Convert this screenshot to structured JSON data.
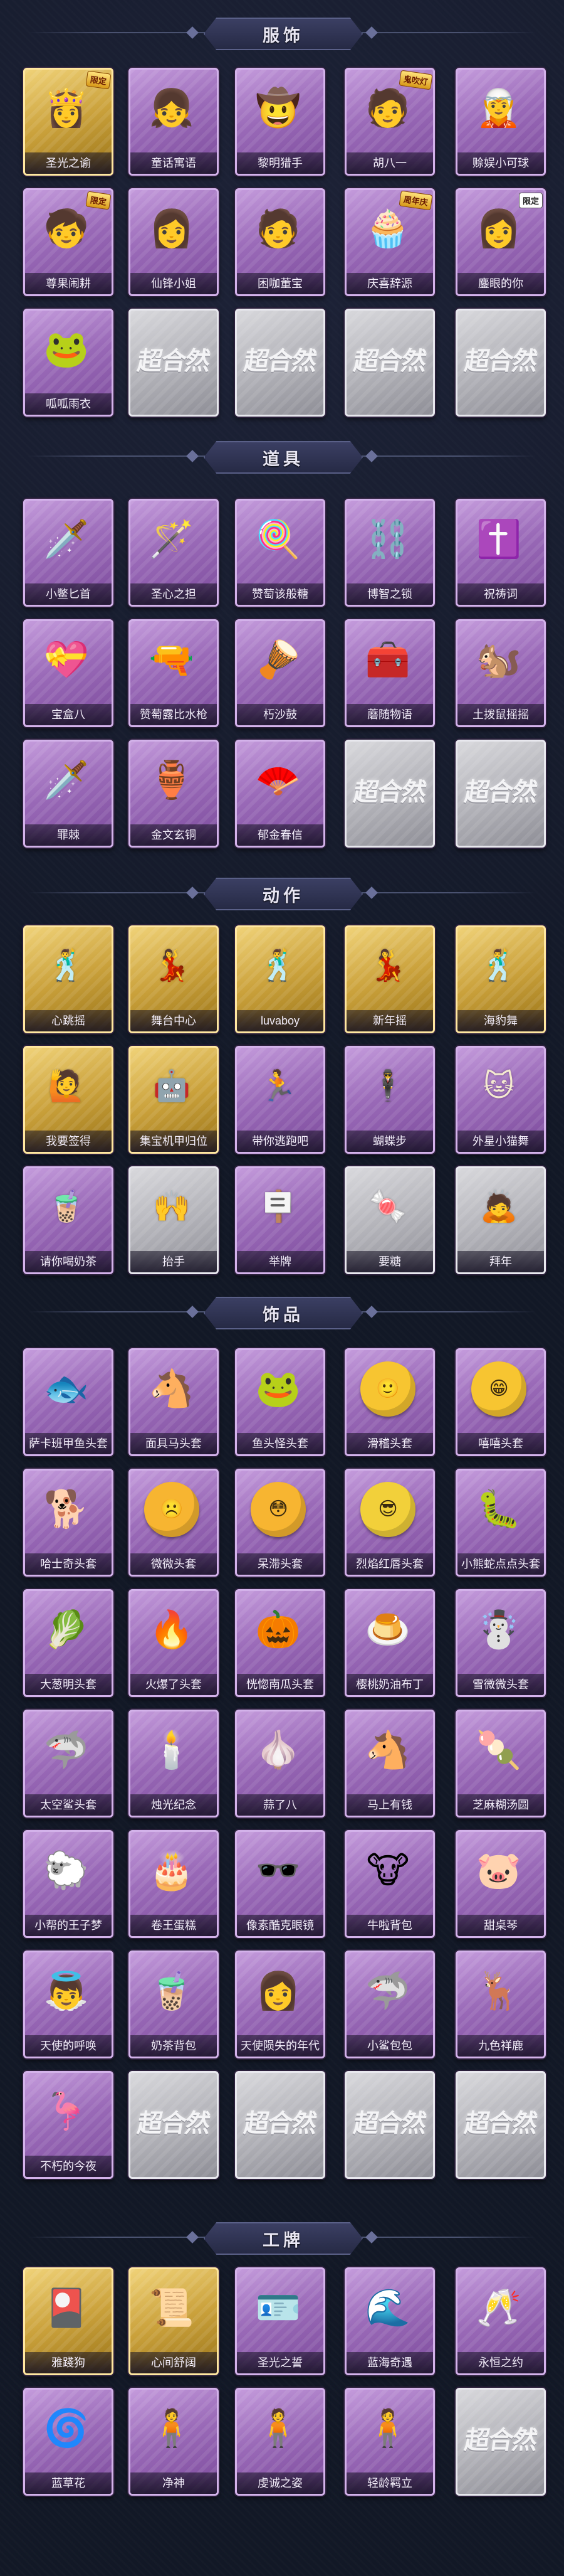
{
  "sections": [
    {
      "title": "服饰",
      "items": [
        {
          "label": "圣光之谕",
          "tier": "gold",
          "art": "👸",
          "badge": "限定"
        },
        {
          "label": "童话寓语",
          "tier": "purple",
          "art": "👧"
        },
        {
          "label": "黎明猎手",
          "tier": "purple",
          "art": "🤠"
        },
        {
          "label": "胡八一",
          "tier": "purple",
          "art": "🧑",
          "badge": "鬼吹灯"
        },
        {
          "label": "赊娱小可球",
          "tier": "purple",
          "art": "🧝"
        },
        {
          "label": "尊果闹耕",
          "tier": "purple",
          "art": "🧒",
          "badge": "限定"
        },
        {
          "label": "仙锋小姐",
          "tier": "purple",
          "art": "👩"
        },
        {
          "label": "困咖董宝",
          "tier": "purple",
          "art": "🧑"
        },
        {
          "label": "庆喜辞源",
          "tier": "purple",
          "art": "🧁",
          "badge": "周年庆"
        },
        {
          "label": "鏖眼的你",
          "tier": "purple",
          "art": "👩",
          "badge": "限定",
          "badge_style": "white"
        },
        {
          "label": "呱呱雨衣",
          "tier": "purple",
          "art": "🐸"
        },
        {
          "label": "",
          "tier": "grey",
          "placeholder": "超合然"
        },
        {
          "label": "",
          "tier": "grey",
          "placeholder": "超合然"
        },
        {
          "label": "",
          "tier": "grey",
          "placeholder": "超合然"
        },
        {
          "label": "",
          "tier": "grey",
          "placeholder": "超合然"
        }
      ]
    },
    {
      "title": "道具",
      "items": [
        {
          "label": "小鳖匕首",
          "tier": "purple",
          "art": "🗡️"
        },
        {
          "label": "圣心之担",
          "tier": "purple",
          "art": "🪄"
        },
        {
          "label": "赞萄该般糖",
          "tier": "purple",
          "art": "🍭"
        },
        {
          "label": "博智之锁",
          "tier": "purple",
          "art": "⛓️"
        },
        {
          "label": "祝祷词",
          "tier": "purple",
          "art": "✝️"
        },
        {
          "label": "宝盒八",
          "tier": "purple",
          "art": "💝"
        },
        {
          "label": "赞萄露比水枪",
          "tier": "purple",
          "art": "🔫"
        },
        {
          "label": "朽沙鼓",
          "tier": "purple",
          "art": "🪘"
        },
        {
          "label": "蘑随物语",
          "tier": "purple",
          "art": "🧰"
        },
        {
          "label": "土拨鼠摇摇",
          "tier": "purple",
          "art": "🐿️"
        },
        {
          "label": "罪棘",
          "tier": "purple",
          "art": "🗡️"
        },
        {
          "label": "金文玄铜",
          "tier": "purple",
          "art": "🏺"
        },
        {
          "label": "郁金春信",
          "tier": "purple",
          "art": "🪭"
        },
        {
          "label": "",
          "tier": "grey",
          "placeholder": "超合然"
        },
        {
          "label": "",
          "tier": "grey",
          "placeholder": "超合然"
        }
      ]
    },
    {
      "title": "动作",
      "items": [
        {
          "label": "心跳摇",
          "tier": "gold",
          "art": "🕺",
          "kind": "pose"
        },
        {
          "label": "舞台中心",
          "tier": "gold",
          "art": "💃",
          "kind": "pose"
        },
        {
          "label": "luvaboy",
          "tier": "gold",
          "art": "🕺",
          "kind": "pose"
        },
        {
          "label": "新年摇",
          "tier": "gold",
          "art": "💃",
          "kind": "pose"
        },
        {
          "label": "海豹舞",
          "tier": "gold",
          "art": "🕺",
          "kind": "pose"
        },
        {
          "label": "我要签得",
          "tier": "gold",
          "art": "🙋",
          "kind": "pose"
        },
        {
          "label": "集宝机甲归位",
          "tier": "gold",
          "art": "🤖",
          "kind": "pose"
        },
        {
          "label": "带你逃跑吧",
          "tier": "purple",
          "art": "🏃",
          "kind": "pose"
        },
        {
          "label": "蝴蝶步",
          "tier": "purple",
          "art": "🕴️",
          "kind": "pose"
        },
        {
          "label": "外星小猫舞",
          "tier": "purple",
          "art": "🐱",
          "kind": "pose"
        },
        {
          "label": "请你喝奶茶",
          "tier": "purple",
          "art": "🧋",
          "kind": "pose"
        },
        {
          "label": "抬手",
          "tier": "grey",
          "art": "🙌",
          "kind": "pose"
        },
        {
          "label": "举牌",
          "tier": "purple",
          "art": "🪧",
          "kind": "pose"
        },
        {
          "label": "要糖",
          "tier": "grey",
          "art": "🍬",
          "kind": "pose"
        },
        {
          "label": "拜年",
          "tier": "grey",
          "art": "🙇",
          "kind": "pose"
        }
      ]
    },
    {
      "title": "饰品",
      "items": [
        {
          "label": "萨卡班甲鱼头套",
          "tier": "purple",
          "art": "🐟"
        },
        {
          "label": "面具马头套",
          "tier": "purple",
          "art": "🐴"
        },
        {
          "label": "鱼头怪头套",
          "tier": "purple",
          "art": "🐸"
        },
        {
          "label": "滑稽头套",
          "tier": "purple",
          "art": "🙂",
          "kind": "blob",
          "blob_color": "#f7c531"
        },
        {
          "label": "嘻嘻头套",
          "tier": "purple",
          "art": "😁",
          "kind": "blob",
          "blob_color": "#f7c531"
        },
        {
          "label": "哈士奇头套",
          "tier": "purple",
          "art": "🐕"
        },
        {
          "label": "微微头套",
          "tier": "purple",
          "art": "☹️",
          "kind": "blob",
          "blob_color": "#f7b531"
        },
        {
          "label": "呆滞头套",
          "tier": "purple",
          "art": "😳",
          "kind": "blob",
          "blob_color": "#f7b531"
        },
        {
          "label": "烈焰红唇头套",
          "tier": "purple",
          "art": "😎",
          "kind": "blob",
          "blob_color": "#f2d03a"
        },
        {
          "label": "小熊蛇点点头套",
          "tier": "purple",
          "art": "🐛"
        },
        {
          "label": "大葱明头套",
          "tier": "purple",
          "art": "🥬"
        },
        {
          "label": "火爆了头套",
          "tier": "purple",
          "art": "🔥"
        },
        {
          "label": "恍惚南瓜头套",
          "tier": "purple",
          "art": "🎃"
        },
        {
          "label": "樱桃奶油布丁",
          "tier": "purple",
          "art": "🍮"
        },
        {
          "label": "雪微微头套",
          "tier": "purple",
          "art": "☃️"
        },
        {
          "label": "太空鲨头套",
          "tier": "purple",
          "art": "🦈"
        },
        {
          "label": "烛光纪念",
          "tier": "purple",
          "art": "🕯️"
        },
        {
          "label": "蒜了八",
          "tier": "purple",
          "art": "🧄"
        },
        {
          "label": "马上有钱",
          "tier": "purple",
          "art": "🐴"
        },
        {
          "label": "芝麻糊汤圆",
          "tier": "purple",
          "art": "🍡"
        },
        {
          "label": "小帮的王子梦",
          "tier": "purple",
          "art": "🐑"
        },
        {
          "label": "卷王蛋糕",
          "tier": "purple",
          "art": "🎂"
        },
        {
          "label": "像素酷克眼镜",
          "tier": "purple",
          "art": "🕶️"
        },
        {
          "label": "牛啦背包",
          "tier": "purple",
          "art": "🐮"
        },
        {
          "label": "甜桌琴",
          "tier": "purple",
          "art": "🐷"
        },
        {
          "label": "天使的呼唤",
          "tier": "purple",
          "art": "👼"
        },
        {
          "label": "奶茶背包",
          "tier": "purple",
          "art": "🧋"
        },
        {
          "label": "天使陨失的年代",
          "tier": "purple",
          "art": "👩"
        },
        {
          "label": "小鲨包包",
          "tier": "purple",
          "art": "🦈"
        },
        {
          "label": "九色祥鹿",
          "tier": "purple",
          "art": "🦌"
        },
        {
          "label": "不朽的今夜",
          "tier": "purple",
          "art": "🦩"
        },
        {
          "label": "",
          "tier": "grey",
          "placeholder": "超合然"
        },
        {
          "label": "",
          "tier": "grey",
          "placeholder": "超合然"
        },
        {
          "label": "",
          "tier": "grey",
          "placeholder": "超合然"
        },
        {
          "label": "",
          "tier": "grey",
          "placeholder": "超合然"
        }
      ]
    },
    {
      "title": "工牌",
      "items": [
        {
          "label": "雅踐狗",
          "tier": "gold",
          "art": "🎴"
        },
        {
          "label": "心间舒阔",
          "tier": "gold",
          "art": "📜"
        },
        {
          "label": "圣光之誓",
          "tier": "purple",
          "art": "🪪"
        },
        {
          "label": "蓝海奇遇",
          "tier": "purple",
          "art": "🌊"
        },
        {
          "label": "永恒之约",
          "tier": "purple",
          "art": "🥂"
        },
        {
          "label": "蓝草花",
          "tier": "purple",
          "art": "🌀"
        },
        {
          "label": "净神",
          "tier": "purple",
          "art": "🧍"
        },
        {
          "label": "虔诚之姿",
          "tier": "purple",
          "art": "🧍"
        },
        {
          "label": "轻龄羁立",
          "tier": "purple",
          "art": "🧍"
        },
        {
          "label": "",
          "tier": "grey",
          "placeholder": "超合然"
        }
      ]
    }
  ]
}
